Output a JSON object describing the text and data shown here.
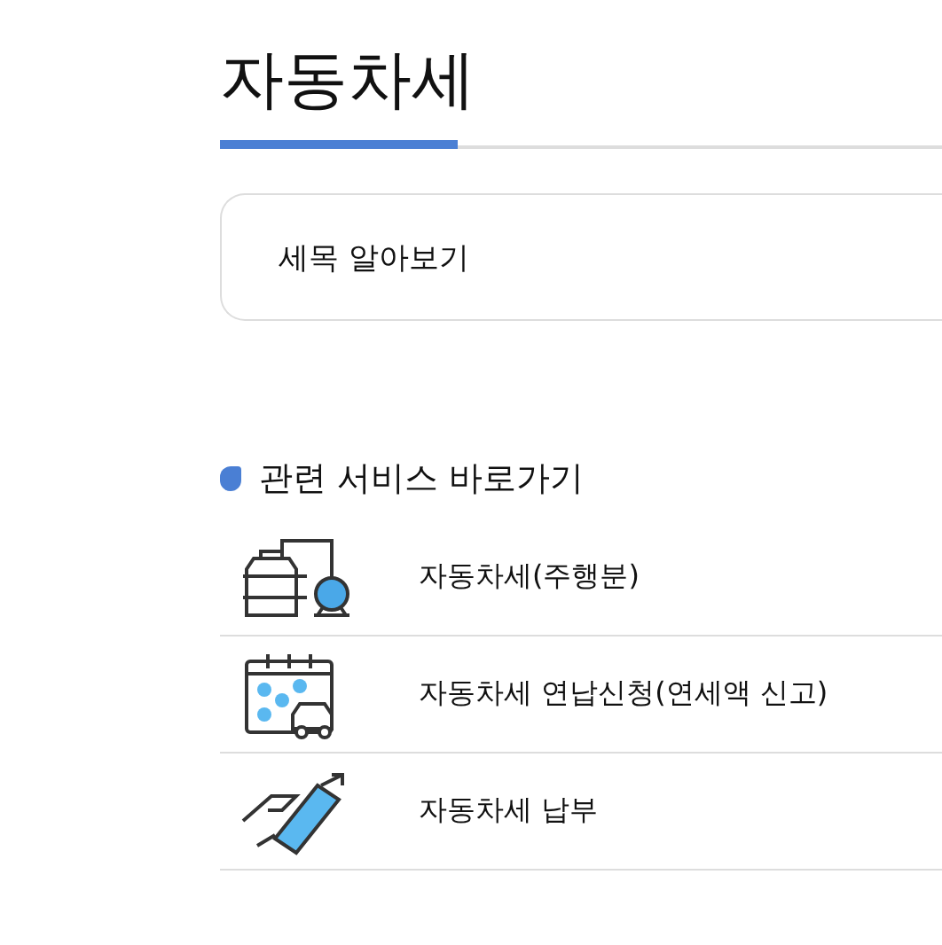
{
  "page_title": "자동차세",
  "tab": {
    "label": "세목 알아보기"
  },
  "related": {
    "heading": "관련 서비스 바로가기",
    "items": [
      {
        "kind": "oil",
        "label": "자동차세(주행분)"
      },
      {
        "kind": "calendar",
        "label": "자동차세 연납신청(연세액 신고)"
      },
      {
        "kind": "card",
        "label": "자동차세 납부"
      }
    ]
  }
}
